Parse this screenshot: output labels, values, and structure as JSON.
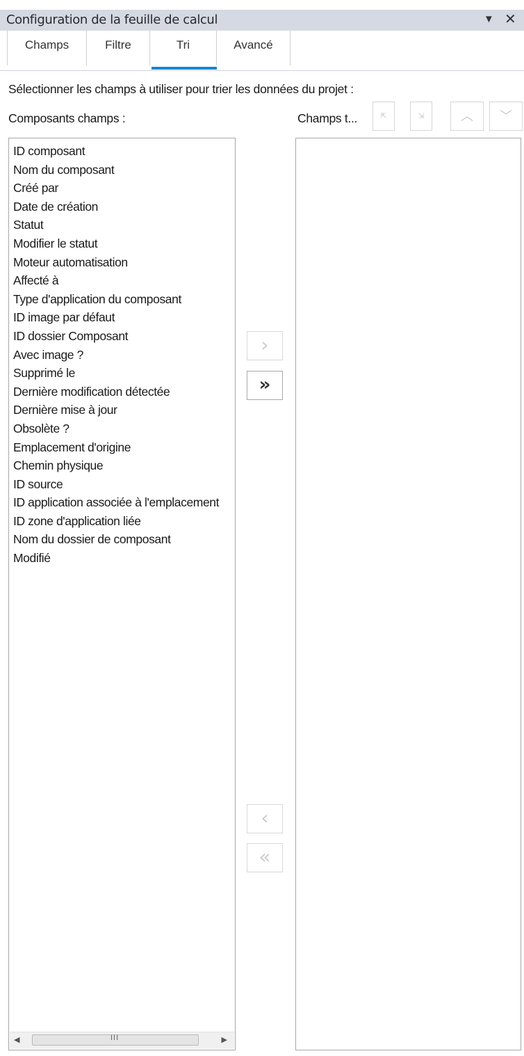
{
  "panel": {
    "title": "Configuration de la feuille de calcul",
    "dropdown_glyph": "▼",
    "close_glyph": "✕"
  },
  "tabs": [
    {
      "label": "Champs"
    },
    {
      "label": "Filtre"
    },
    {
      "label": "Tri",
      "active": true
    },
    {
      "label": "Avancé"
    }
  ],
  "sort": {
    "instruction": "Sélectionner les champs à utiliser pour trier les données du projet :",
    "left_label": "Composants champs :",
    "right_label": "Champs t...",
    "toolbar": {
      "move_top_glyph": "⇱",
      "move_bottom_glyph": "⇲",
      "move_up_glyph": "︿",
      "move_down_glyph": "﹀"
    },
    "source_items": [
      "ID composant",
      "Nom du composant",
      "Créé par",
      "Date de création",
      "Statut",
      "Modifier le statut",
      "Moteur automatisation",
      "Affecté à",
      "Type d'application du composant",
      "ID image par défaut",
      "ID dossier Composant",
      "Avec image ?",
      "Supprimé le",
      "Dernière modification détectée",
      "Dernière mise à jour",
      "Obsolète ?",
      "Emplacement d'origine",
      "Chemin physique",
      "ID source",
      "ID application associée à l'emplacement",
      "ID zone d'application liée",
      "Nom du dossier de composant",
      "Modifié"
    ],
    "target_items": [],
    "transfer": {
      "add_glyph": "›",
      "add_all_glyph": "»",
      "remove_glyph": "‹",
      "remove_all_glyph": "«"
    },
    "scrollbar": {
      "left_glyph": "◀",
      "right_glyph": "▶",
      "grip_glyph": "III"
    }
  },
  "colors": {
    "titlebar_bg": "#d4d9e2",
    "active_tab_indicator": "#1587d4"
  }
}
